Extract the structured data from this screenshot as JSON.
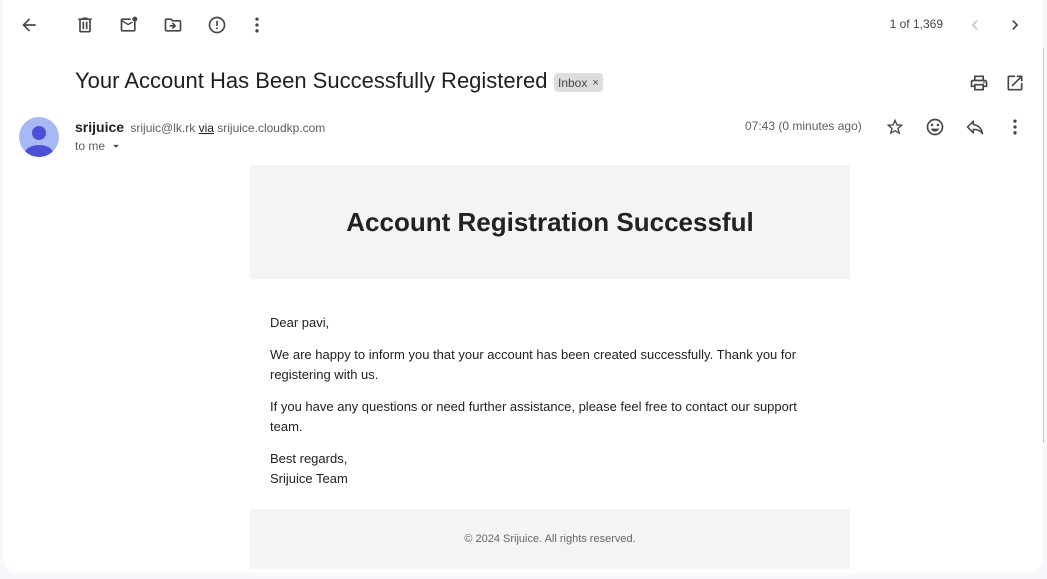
{
  "toolbar": {
    "back_icon": "arrow-left-icon",
    "delete_icon": "trash-icon",
    "mark_unread_icon": "mail-unread-icon",
    "move_icon": "folder-move-icon",
    "spam_icon": "report-spam-icon",
    "more_icon": "more-vert-icon",
    "pager": "1 of 1,369",
    "newer_icon": "chevron-left-icon",
    "older_icon": "chevron-right-icon"
  },
  "message": {
    "subject": "Your Account Has Been Successfully Registered",
    "label": "Inbox",
    "label_remove": "×",
    "print_icon": "print-icon",
    "popout_icon": "open-in-new-icon",
    "sender": {
      "name": "srijuice",
      "email": "srijuic@lk.rk",
      "via_label": "via",
      "via_domain": "srijuice.cloudkp.com",
      "recipient": "to me"
    },
    "time": "07:43 (0 minutes ago)",
    "action_icons": [
      "star-icon",
      "emoji-icon",
      "reply-icon",
      "more-vert-icon"
    ]
  },
  "email": {
    "heading": "Account Registration Successful",
    "greeting": "Dear pavi,",
    "paragraph1": "We are happy to inform you that your account has been created successfully. Thank you for registering with us.",
    "paragraph2": "If you have any questions or need further assistance, please feel free to contact our support team.",
    "signoff": "Best regards,",
    "signature": "Srijuice Team",
    "footer": "© 2024 Srijuice. All rights reserved."
  },
  "colors": {
    "page_bg": "#f6f8fc",
    "avatar": "#a8b8f4",
    "avatar_figure": "#4d4fd6",
    "email_band": "#f4f4f4"
  }
}
